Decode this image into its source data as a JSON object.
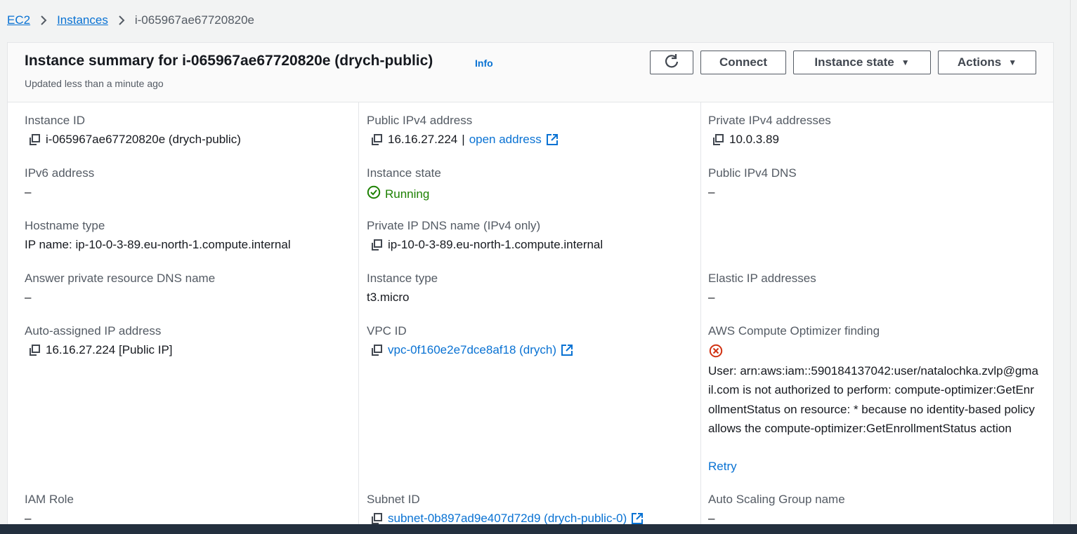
{
  "breadcrumb": {
    "items": [
      "EC2",
      "Instances"
    ],
    "current": "i-065967ae67720820e"
  },
  "header": {
    "title": "Instance summary for i-065967ae67720820e (drych-public)",
    "info": "Info",
    "subtitle": "Updated less than a minute ago",
    "buttons": {
      "connect": "Connect",
      "instance_state": "Instance state",
      "actions": "Actions"
    }
  },
  "details": {
    "instance_id": {
      "label": "Instance ID",
      "value": "i-065967ae67720820e (drych-public)"
    },
    "ipv6": {
      "label": "IPv6 address",
      "value": "–"
    },
    "hostname_type": {
      "label": "Hostname type",
      "value": "IP name: ip-10-0-3-89.eu-north-1.compute.internal"
    },
    "answer_dns": {
      "label": "Answer private resource DNS name",
      "value": "–"
    },
    "auto_ip": {
      "label": "Auto-assigned IP address",
      "value": "16.16.27.224 [Public IP]"
    },
    "iam_role": {
      "label": "IAM Role",
      "value": "–"
    },
    "public_ipv4": {
      "label": "Public IPv4 address",
      "value": "16.16.27.224",
      "separator": "|",
      "link": "open address"
    },
    "instance_state": {
      "label": "Instance state",
      "value": "Running"
    },
    "private_dns": {
      "label": "Private IP DNS name (IPv4 only)",
      "value": "ip-10-0-3-89.eu-north-1.compute.internal"
    },
    "instance_type": {
      "label": "Instance type",
      "value": "t3.micro"
    },
    "vpc_id": {
      "label": "VPC ID",
      "value": "vpc-0f160e2e7dce8af18 (drych)"
    },
    "subnet_id": {
      "label": "Subnet ID",
      "value": "subnet-0b897ad9e407d72d9 (drych-public-0)"
    },
    "private_ipv4": {
      "label": "Private IPv4 addresses",
      "value": "10.0.3.89"
    },
    "public_dns": {
      "label": "Public IPv4 DNS",
      "value": "–"
    },
    "elastic_ip": {
      "label": "Elastic IP addresses",
      "value": "–"
    },
    "optimizer": {
      "label": "AWS Compute Optimizer finding",
      "error": "User: arn:aws:iam::590184137042:user/natalochka.zvlp@gmail.com is not authorized to perform: compute-optimizer:GetEnrollmentStatus on resource: * because no identity-based policy allows the compute-optimizer:GetEnrollmentStatus action",
      "retry": "Retry"
    },
    "asg": {
      "label": "Auto Scaling Group name",
      "value": "–"
    }
  },
  "colors": {
    "link": "#0972d3",
    "running": "#1d8102",
    "error": "#d13212",
    "bottom_bar": "#232f3e"
  },
  "icons": [
    "chevron-right-icon",
    "refresh-icon",
    "caret-down-icon",
    "copy-icon",
    "external-link-icon",
    "check-circle-icon",
    "error-circle-icon"
  ]
}
